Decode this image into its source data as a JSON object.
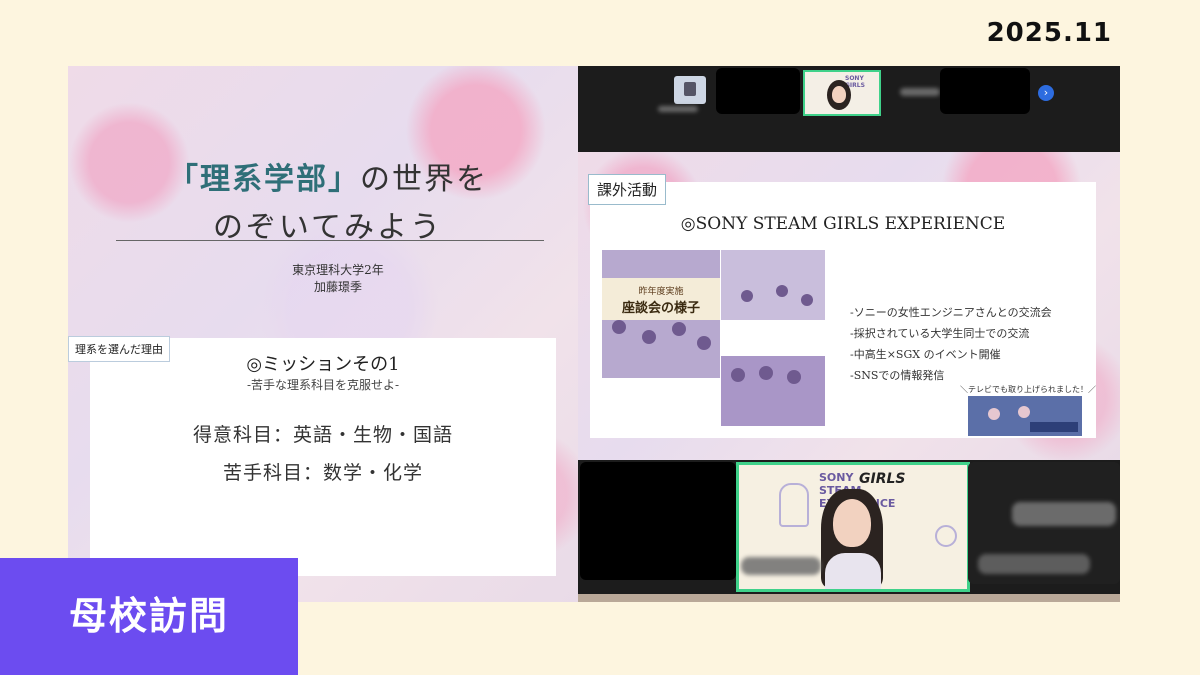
{
  "header": {
    "date": "2025.11"
  },
  "left_slide": {
    "title_accent": "「理系学部」",
    "title_rest": "の世界を",
    "title_line2": "のぞいてみよう",
    "affiliation": "東京理科大学2年",
    "name": "加藤璟季",
    "reason_tag": "理系を選んだ理由",
    "mission_title": "◎ミッションその1",
    "mission_subtitle": "-苦手な理系科目を克服せよ-",
    "strong_subjects": "得意科目：英語・生物・国語",
    "weak_subjects": "苦手科目：数学・化学"
  },
  "right_slide": {
    "tag": "課外活動",
    "title": "◎SONY STEAM GIRLS EXPERIENCE",
    "photo_label_small": "昨年度実施",
    "photo_label_main": "座談会の様子",
    "bullets": [
      "-ソニーの女性エンジニアさんとの交流会",
      "-採択されている大学生同士での交流",
      "-中高生×SGX のイベント開催",
      "-SNSでの情報発信"
    ],
    "tv_note": "＼テレビでも取り上げられました！／"
  },
  "video": {
    "sony_lines": [
      "SONY",
      "STEAM",
      "EXPERIENCE"
    ],
    "girls": "GIRLS"
  },
  "thumbnail": {
    "sony": "SONY",
    "girls": "GIRLS"
  },
  "label": {
    "text": "母校訪問"
  },
  "colors": {
    "label_bg": "#6c4cf0",
    "active_border": "#3fd18a",
    "page_bg": "#fdf5df"
  }
}
